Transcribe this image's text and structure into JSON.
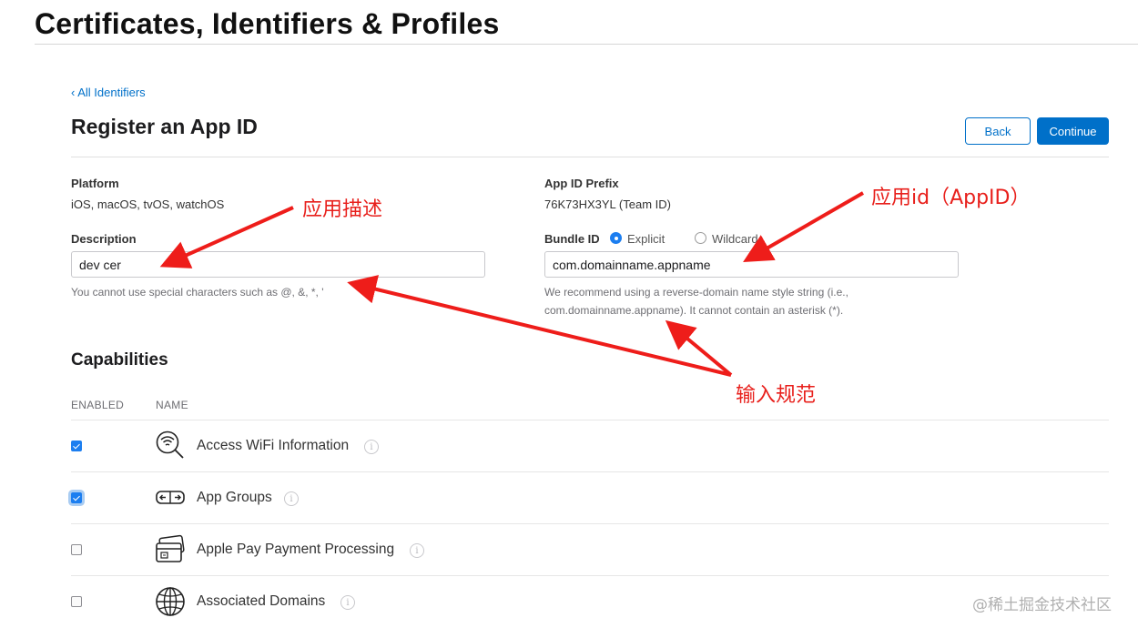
{
  "header": {
    "title": "Certificates, Identifiers & Profiles"
  },
  "nav": {
    "back_link": "‹ All Identifiers"
  },
  "form": {
    "title": "Register an App ID",
    "back_button": "Back",
    "continue_button": "Continue",
    "platform": {
      "label": "Platform",
      "value": "iOS, macOS, tvOS, watchOS"
    },
    "prefix": {
      "label": "App ID Prefix",
      "value": "76K73HX3YL (Team ID)"
    },
    "description": {
      "label": "Description",
      "value": "dev cer",
      "hint": "You cannot use special characters such as @, &, *, '"
    },
    "bundle": {
      "label": "Bundle ID",
      "options": [
        {
          "label": "Explicit",
          "selected": true
        },
        {
          "label": "Wildcard",
          "selected": false
        }
      ],
      "value": "com.domainname.appname",
      "hint_line1": "We recommend using a reverse-domain name style string (i.e.,",
      "hint_line2": "com.domainname.appname). It cannot contain an asterisk (*)."
    }
  },
  "capabilities": {
    "title": "Capabilities",
    "col_enabled": "ENABLED",
    "col_name": "NAME",
    "items": [
      {
        "name": "Access WiFi Information",
        "enabled": true,
        "icon": "wifi-search-icon"
      },
      {
        "name": "App Groups",
        "enabled": true,
        "icon": "app-groups-icon"
      },
      {
        "name": "Apple Pay Payment Processing",
        "enabled": false,
        "icon": "wallet-card-icon"
      },
      {
        "name": "Associated Domains",
        "enabled": false,
        "icon": "globe-icon"
      }
    ]
  },
  "annotations": {
    "description_note": "应用描述",
    "appid_note": "应用id（AppID）",
    "rules_note": "输入规范"
  },
  "watermark": "@稀土掘金技术社区",
  "colors": {
    "accent": "#0070c9",
    "checkbox": "#1c7ef0",
    "annotation": "#e8201c"
  }
}
